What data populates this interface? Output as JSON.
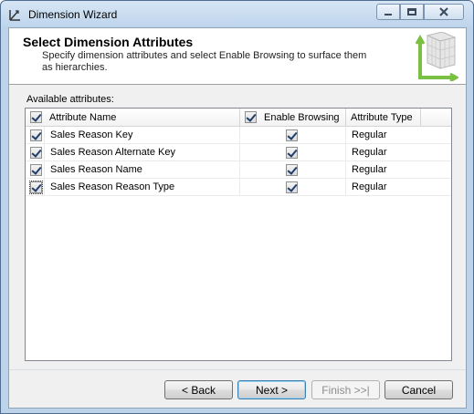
{
  "window": {
    "title": "Dimension Wizard",
    "controls": {
      "minimize": "minimize",
      "maximize": "maximize",
      "close": "close"
    }
  },
  "header": {
    "title": "Select Dimension Attributes",
    "description": "Specify dimension attributes and select Enable Browsing to surface them as hierarchies."
  },
  "attributes": {
    "label": "Available attributes:",
    "columns": {
      "name": "Attribute Name",
      "browsing": "Enable Browsing",
      "type": "Attribute Type"
    },
    "select_all": true,
    "browse_all": true,
    "rows": [
      {
        "include": true,
        "name": "Sales Reason Key",
        "enable_browsing": true,
        "type": "Regular"
      },
      {
        "include": true,
        "name": "Sales Reason Alternate Key",
        "enable_browsing": true,
        "type": "Regular"
      },
      {
        "include": true,
        "name": "Sales Reason Name",
        "enable_browsing": true,
        "type": "Regular"
      },
      {
        "include": true,
        "name": "Sales Reason Reason Type",
        "enable_browsing": true,
        "type": "Regular"
      }
    ]
  },
  "buttons": {
    "back": "< Back",
    "next": "Next >",
    "finish": "Finish >>|",
    "cancel": "Cancel"
  },
  "icons": {
    "app": "dimension-wizard-icon",
    "header": "dimension-cube-icon"
  }
}
